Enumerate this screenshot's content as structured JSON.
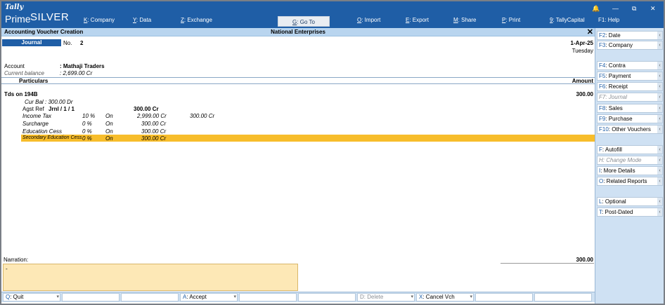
{
  "app": {
    "logo_top": "Tally",
    "logo_bottom": "Prime",
    "edition": "SILVER"
  },
  "top_menu": [
    {
      "key": "K",
      "label": ": Company"
    },
    {
      "key": "Y",
      "label": ": Data"
    },
    {
      "key": "Z",
      "label": ": Exchange"
    },
    {
      "key": "G",
      "label": ": Go To"
    },
    {
      "key": "O",
      "label": ": Import"
    },
    {
      "key": "E",
      "label": ": Export"
    },
    {
      "key": "M",
      "label": ": Share"
    },
    {
      "key": "P",
      "label": ": Print"
    },
    {
      "key": "9",
      "label": ": TallyCapital"
    },
    {
      "key": "F1",
      "label": ": Help"
    }
  ],
  "window_controls": [
    "🔔",
    "—",
    "⧉",
    "✕"
  ],
  "screen": {
    "title": "Accounting Voucher Creation",
    "company": "National Enterprises",
    "close": "✕"
  },
  "voucher": {
    "type": "Journal",
    "no_label": "No.",
    "number": "2",
    "date": "1-Apr-25",
    "day": "Tuesday",
    "account_label": "Account",
    "account_value": ": Mathaji Traders",
    "balance_label": "Current balance",
    "balance_value": ": 2,699.00 Cr",
    "col_particulars": "Particulars",
    "col_amount": "Amount",
    "ledger_name": "Tds on 194B",
    "ledger_amount": "300.00",
    "cur_bal_label": "Cur Bal",
    "cur_bal_value": ": 300.00 Dr",
    "agst_ref_label": "Agst Ref",
    "agst_ref_value": "Jrnl / 1 / 1",
    "agst_ref_amount": "300.00 Cr",
    "duty_rows": [
      {
        "name": "Income Tax",
        "rate": "10 %",
        "on": "On",
        "base": "2,999.00 Cr",
        "amount": "300.00 Cr"
      },
      {
        "name": "Surcharge",
        "rate": "0 %",
        "on": "On",
        "base": "300.00 Cr",
        "amount": ""
      },
      {
        "name": "Education Cess",
        "rate": "0 %",
        "on": "On",
        "base": "300.00 Cr",
        "amount": ""
      },
      {
        "name": "Secondary Education Cess",
        "rate": "0 %",
        "on": "On",
        "base": "300.00 Cr",
        "amount": ""
      }
    ],
    "narration_label": "Narration:",
    "narration_text": "-",
    "total": "300.00"
  },
  "right_panel": [
    {
      "key": "F2",
      "label": ": Date",
      "arrow": "‹",
      "disabled": false
    },
    {
      "key": "F3",
      "label": ": Company",
      "arrow": "‹",
      "disabled": false
    },
    {
      "key": "F4",
      "label": ": Contra",
      "arrow": "‹",
      "disabled": false
    },
    {
      "key": "F5",
      "label": ": Payment",
      "arrow": "‹",
      "disabled": false
    },
    {
      "key": "F6",
      "label": ": Receipt",
      "arrow": "‹",
      "disabled": false
    },
    {
      "key": "F7",
      "label": ": Journal",
      "arrow": "‹",
      "disabled": true
    },
    {
      "key": "F8",
      "label": ": Sales",
      "arrow": "‹",
      "disabled": false
    },
    {
      "key": "F9",
      "label": ": Purchase",
      "arrow": "‹",
      "disabled": false
    },
    {
      "key": "F10",
      "label": ": Other Vouchers",
      "arrow": "‹",
      "disabled": false
    },
    {
      "key": "F",
      "label": ": Autofill",
      "arrow": "‹",
      "disabled": false
    },
    {
      "key": "H",
      "label": ": Change Mode",
      "arrow": "‹",
      "disabled": true
    },
    {
      "key": "I",
      "label": ": More Details",
      "arrow": "‹",
      "disabled": false
    },
    {
      "key": "O",
      "label": ": Related Reports",
      "arrow": "‹",
      "disabled": false
    },
    {
      "key": "L",
      "label": ": Optional",
      "arrow": "‹",
      "disabled": false
    },
    {
      "key": "T",
      "label": ": Post-Dated",
      "arrow": "‹",
      "disabled": false
    }
  ],
  "bottom_bar": [
    {
      "key": "Q",
      "label": ": Quit",
      "disabled": false
    },
    {
      "key": "",
      "label": "",
      "disabled": false
    },
    {
      "key": "",
      "label": "",
      "disabled": false
    },
    {
      "key": "A",
      "label": ": Accept",
      "disabled": false
    },
    {
      "key": "",
      "label": "",
      "disabled": false
    },
    {
      "key": "",
      "label": "",
      "disabled": false
    },
    {
      "key": "D",
      "label": ": Delete",
      "disabled": true
    },
    {
      "key": "X",
      "label": ": Cancel Vch",
      "disabled": false
    },
    {
      "key": "",
      "label": "",
      "disabled": false
    },
    {
      "key": "",
      "label": "",
      "disabled": false
    }
  ],
  "colors": {
    "brand_blue": "#1f5ea6",
    "title_bar": "#b9d5ef",
    "highlight": "#f7bd2b",
    "narration_bg": "#fde8b6",
    "panel_bg": "#cfe1f3"
  }
}
